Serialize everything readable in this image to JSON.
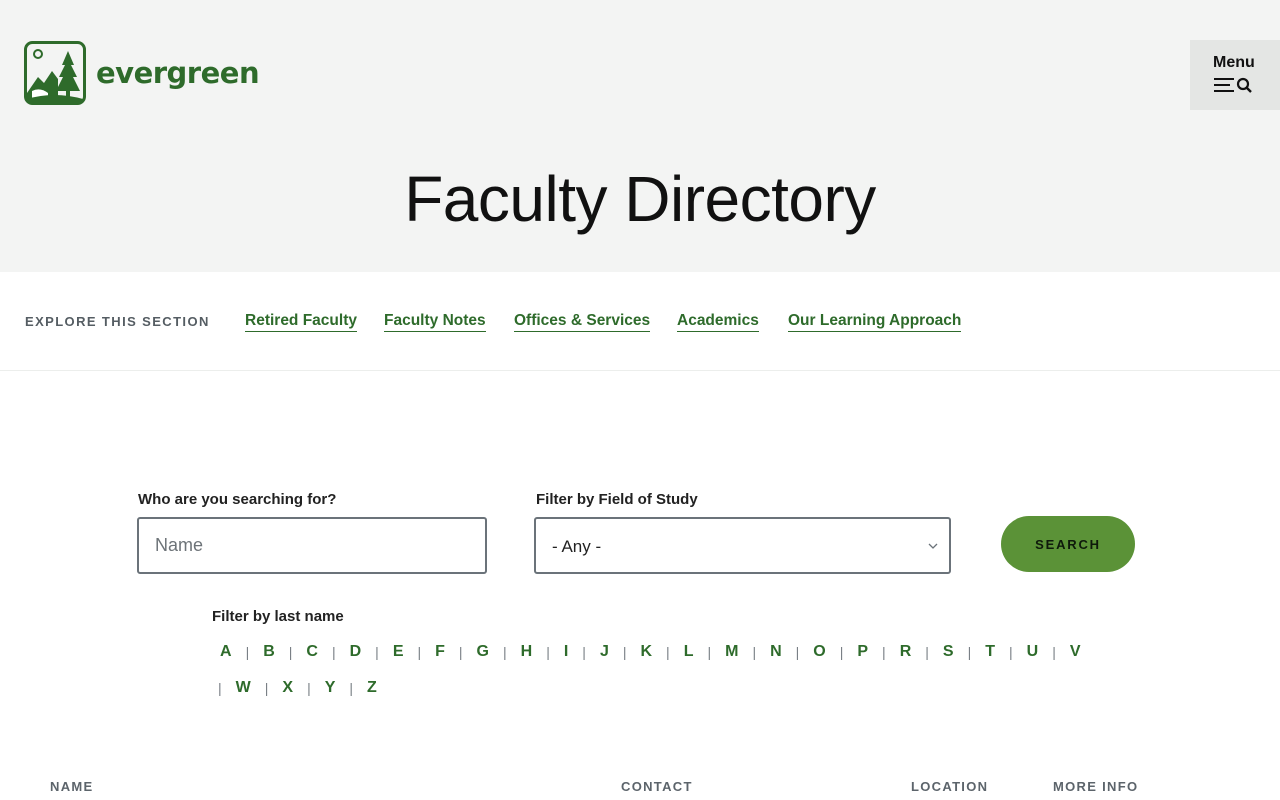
{
  "header": {
    "logo_text": "evergreen",
    "menu_label": "Menu",
    "page_title": "Faculty Directory"
  },
  "explore": {
    "label": "EXPLORE THIS SECTION",
    "links": [
      "Retired Faculty",
      "Faculty Notes",
      "Offices & Services",
      "Academics",
      "Our Learning Approach"
    ]
  },
  "search": {
    "name_label": "Who are you searching for?",
    "name_placeholder": "Name",
    "field_label": "Filter by Field of Study",
    "field_value": "- Any -",
    "button_label": "SEARCH"
  },
  "alphabet": {
    "label": "Filter by last name",
    "row1": [
      "A",
      "B",
      "C",
      "D",
      "E",
      "F",
      "G",
      "H",
      "I",
      "J",
      "K",
      "L",
      "M",
      "N",
      "O",
      "P",
      "R",
      "S",
      "T",
      "U",
      "V"
    ],
    "row2": [
      "W",
      "X",
      "Y",
      "Z"
    ]
  },
  "table": {
    "columns": [
      "NAME",
      "CONTACT",
      "LOCATION",
      "MORE INFO"
    ]
  },
  "colors": {
    "brand_green": "#2e6b2b",
    "button_green": "#5b9237",
    "hero_bg": "#f3f4f3"
  },
  "icons": [
    "evergreen-logo-icon",
    "hamburger-icon",
    "search-icon",
    "chevron-down-icon"
  ]
}
